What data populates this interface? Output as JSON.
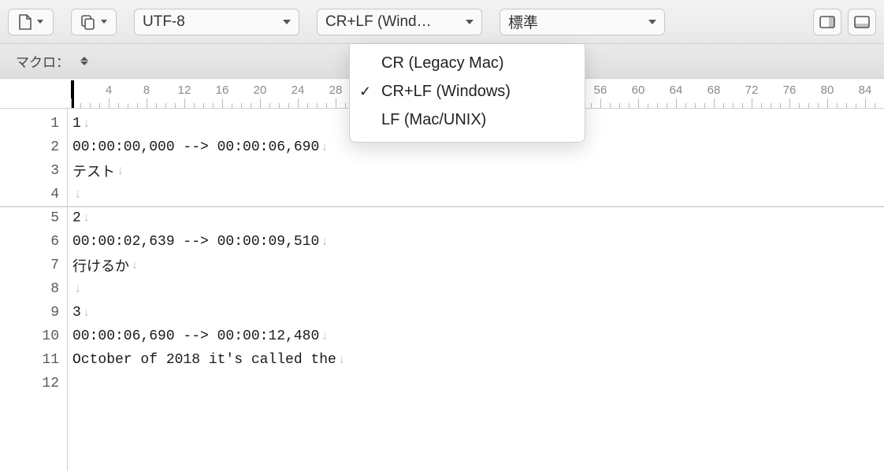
{
  "toolbar": {
    "encoding": "UTF-8",
    "line_ending": "CR+LF (Wind…",
    "syntax": "標準"
  },
  "macro": {
    "label": "マクロ："
  },
  "ruler": {
    "marks": [
      4,
      8,
      12,
      16,
      20,
      24,
      28,
      56,
      60,
      64,
      68,
      72,
      76,
      80,
      84
    ]
  },
  "menu": {
    "items": [
      {
        "label": "CR (Legacy Mac)",
        "checked": false
      },
      {
        "label": "CR+LF (Windows)",
        "checked": true
      },
      {
        "label": "LF (Mac/UNIX)",
        "checked": false
      }
    ]
  },
  "editor": {
    "lines": [
      "1",
      "00:00:00,000 --> 00:00:06,690",
      "テスト",
      "",
      "2",
      "00:00:02,639 --> 00:00:09,510",
      "行けるか",
      "",
      "3",
      "00:00:06,690 --> 00:00:12,480",
      "October of 2018 it's called the",
      ""
    ]
  }
}
